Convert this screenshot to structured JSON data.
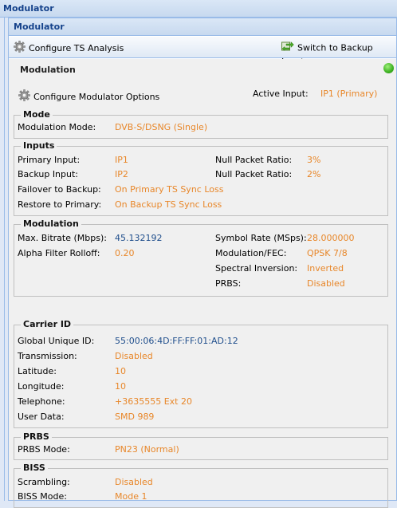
{
  "outer_panel": {
    "title": "Modulator"
  },
  "window": {
    "title": "Modulator"
  },
  "toolbar": {
    "configure_ts_label": "Configure TS Analysis",
    "switch_backup_label": "Switch to Backup Input"
  },
  "modulation_header": {
    "title": "Modulation",
    "status_color": "#3cb020",
    "configure_options_label": "Configure Modulator Options",
    "active_input_label": "Active Input:",
    "active_input_value": "IP1 (Primary)"
  },
  "mode": {
    "legend": "Mode",
    "modulation_mode_label": "Modulation Mode:",
    "modulation_mode_value": "DVB-S/DSNG (Single)"
  },
  "inputs": {
    "legend": "Inputs",
    "primary_label": "Primary Input:",
    "primary_value": "IP1",
    "backup_label": "Backup Input:",
    "backup_value": "IP2",
    "failover_label": "Failover to Backup:",
    "failover_value": "On Primary TS Sync Loss",
    "restore_label": "Restore to Primary:",
    "restore_value": "On Backup TS Sync Loss",
    "null_ratio_1_label": "Null Packet Ratio:",
    "null_ratio_1_value": "3%",
    "null_ratio_2_label": "Null Packet Ratio:",
    "null_ratio_2_value": "2%"
  },
  "modulation": {
    "legend": "Modulation",
    "max_bitrate_label": "Max. Bitrate (Mbps):",
    "max_bitrate_value": "45.132192",
    "alpha_label": "Alpha Filter Rolloff:",
    "alpha_value": "0.20",
    "symbol_rate_label": "Symbol Rate (MSps):",
    "symbol_rate_value": "28.000000",
    "modfec_label": "Modulation/FEC:",
    "modfec_value": "QPSK 7/8",
    "spectral_label": "Spectral Inversion:",
    "spectral_value": "Inverted",
    "prbs_label": "PRBS:",
    "prbs_value": "Disabled"
  },
  "carrier_id": {
    "legend": "Carrier ID",
    "guid_label": "Global Unique ID:",
    "guid_value": "55:00:06:4D:FF:FF:01:AD:12",
    "transmission_label": "Transmission:",
    "transmission_value": "Disabled",
    "latitude_label": "Latitude:",
    "latitude_value": "10",
    "longitude_label": "Longitude:",
    "longitude_value": "10",
    "telephone_label": "Telephone:",
    "telephone_value": "+3635555 Ext 20",
    "userdata_label": "User Data:",
    "userdata_value": "SMD 989"
  },
  "prbs": {
    "legend": "PRBS",
    "mode_label": "PRBS Mode:",
    "mode_value": "PN23 (Normal)"
  },
  "biss": {
    "legend": "BISS",
    "scrambling_label": "Scrambling:",
    "scrambling_value": "Disabled",
    "mode_label": "BISS Mode:",
    "mode_value": "Mode 1"
  },
  "colors": {
    "value_orange": "#e8872a",
    "value_blue": "#1f4e8c",
    "header_text": "#15428b"
  }
}
